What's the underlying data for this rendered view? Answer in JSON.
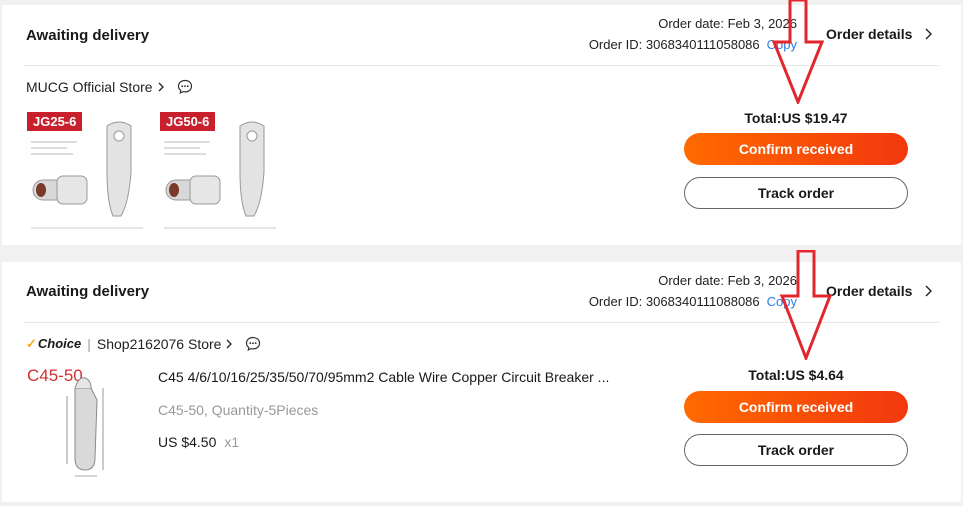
{
  "orders": [
    {
      "status": "Awaiting delivery",
      "order_date": "Order date: Feb 3, 2026",
      "order_id": "Order ID: 3068340111058086",
      "copy": "Copy",
      "details": "Order details",
      "store": "MUCG Official Store",
      "thumbs": [
        {
          "tag": "JG25-6"
        },
        {
          "tag": "JG50-6"
        }
      ],
      "total": "Total:US $19.47",
      "confirm": "Confirm received",
      "track": "Track order"
    },
    {
      "status": "Awaiting delivery",
      "order_date": "Order date: Feb 3, 2026",
      "order_id": "Order ID: 3068340111088086",
      "copy": "Copy",
      "details": "Order details",
      "choice": "Choice",
      "store": "Shop2162076 Store",
      "thumb_tag": "C45-50",
      "product_title": "C45 4/6/10/16/25/35/50/70/95mm2 Cable Wire Copper Circuit Breaker ...",
      "sku": "C45-50, Quantity-5Pieces",
      "price": "US $4.50",
      "qty": "x1",
      "total": "Total:US $4.64",
      "confirm": "Confirm received",
      "track": "Track order"
    }
  ],
  "colors": {
    "accent": "#ff6a00",
    "arrow": "#e3262e",
    "link": "#2e7ae6"
  }
}
